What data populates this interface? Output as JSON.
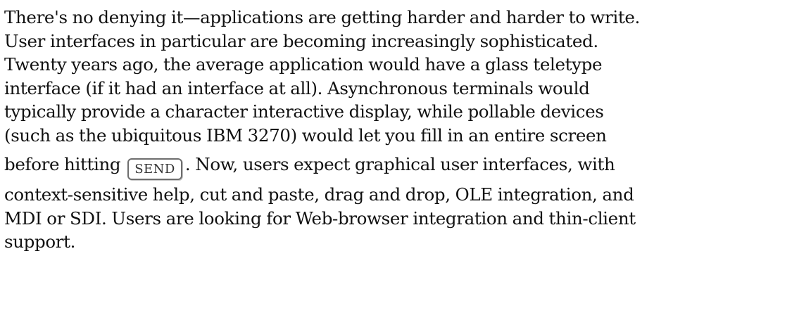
{
  "document": {
    "lines": [
      "There's no denying it—applications are getting harder and harder to write.",
      "User interfaces in particular are becoming increasingly sophisticated.",
      "Twenty years ago, the average application would have a glass teletype",
      "interface (if it had an interface at all). Asynchronous terminals would",
      "typically provide a character interactive display, while pollable devices",
      "(such as the ubiquitous IBM 3270) would let you fill in an entire screen"
    ],
    "key_line": {
      "before": "before hitting",
      "key_label": "SEND",
      "after": ". Now, users expect graphical user interfaces, with"
    },
    "lines_after": [
      "context-sensitive help, cut and paste, drag and drop, OLE integration, and",
      "MDI or SDI. Users are looking for Web-browser integration and thin-client",
      "support."
    ]
  }
}
